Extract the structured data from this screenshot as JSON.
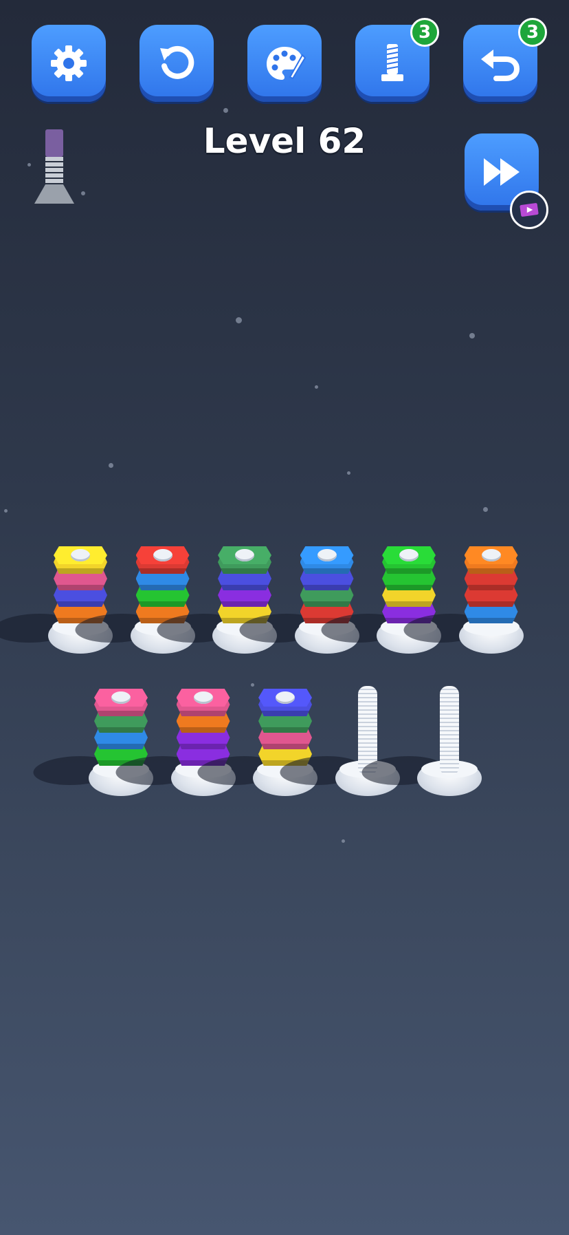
{
  "level": {
    "title": "Level 62"
  },
  "toolbar": {
    "buttons": [
      {
        "name": "settings",
        "icon": "gear-icon",
        "badge": null
      },
      {
        "name": "restart",
        "icon": "restart-icon",
        "badge": null
      },
      {
        "name": "theme",
        "icon": "palette-icon",
        "badge": null
      },
      {
        "name": "add-bolt",
        "icon": "bolt-icon",
        "badge": "3"
      },
      {
        "name": "undo",
        "icon": "undo-icon",
        "badge": "3"
      }
    ],
    "skip": {
      "icon": "fast-forward-icon",
      "ad_icon": "video-ad-icon"
    }
  },
  "colors": {
    "yellow": "#f2d42a",
    "pink": "#e0578f",
    "blue": "#2f8ae6",
    "orange": "#ef7a1f",
    "red": "#dc3a33",
    "green": "#25c432",
    "darkgreen": "#3f9b5c",
    "indigo": "#4b4fe0",
    "purple": "#8a2ee0",
    "accent": "#2f74ea",
    "badge": "#1ea63a"
  },
  "board": {
    "rows": [
      [
        {
          "nuts": [
            "yellow",
            "pink",
            "indigo",
            "orange"
          ]
        },
        {
          "nuts": [
            "red",
            "blue",
            "green",
            "orange"
          ]
        },
        {
          "nuts": [
            "darkgreen",
            "indigo",
            "purple",
            "yellow"
          ]
        },
        {
          "nuts": [
            "blue",
            "indigo",
            "darkgreen",
            "red"
          ]
        },
        {
          "nuts": [
            "green",
            "green",
            "yellow",
            "purple"
          ]
        },
        {
          "nuts": [
            "orange",
            "red",
            "red",
            "blue"
          ]
        }
      ],
      [
        {
          "nuts": [
            "pink",
            "darkgreen",
            "blue",
            "green"
          ]
        },
        {
          "nuts": [
            "pink",
            "orange",
            "purple",
            "purple"
          ]
        },
        {
          "nuts": [
            "indigo",
            "darkgreen",
            "pink",
            "yellow"
          ]
        },
        {
          "nuts": []
        },
        {
          "nuts": []
        }
      ]
    ]
  }
}
